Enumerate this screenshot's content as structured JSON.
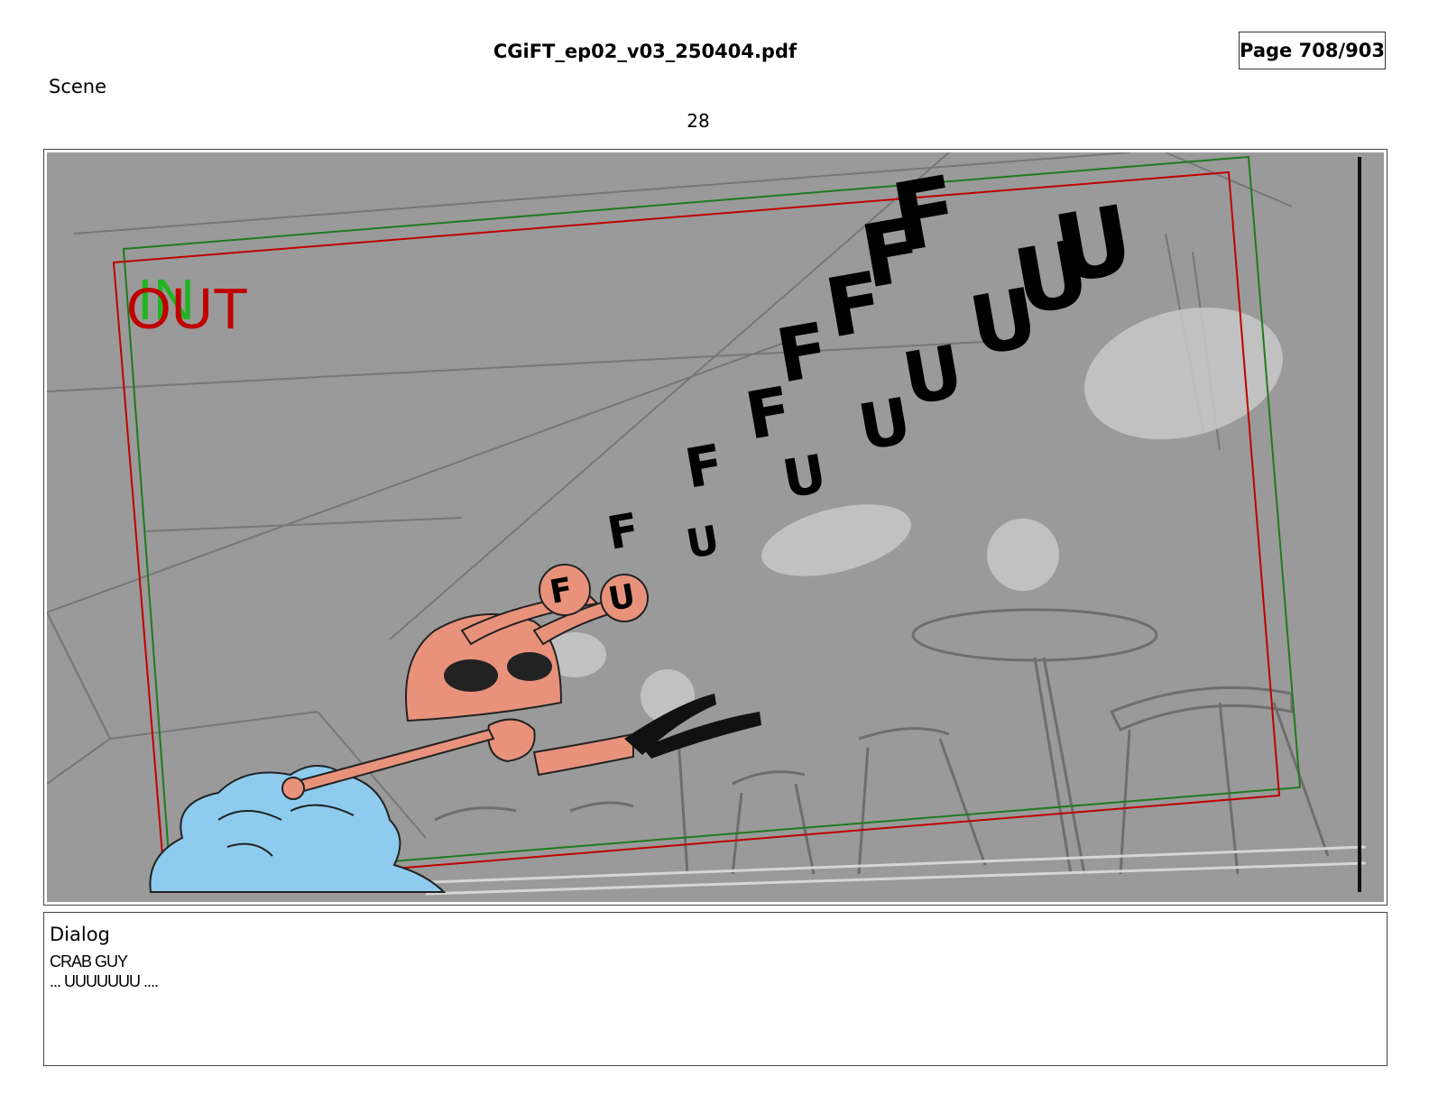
{
  "header": {
    "file_title": "CGiFT_ep02_v03_250404.pdf",
    "page_indicator": "Page 708/903"
  },
  "scene": {
    "label": "Scene",
    "number": "28"
  },
  "panel": {
    "in_label": "IN",
    "out_label": "OUT",
    "sfx_f": "F",
    "sfx_u": "U",
    "colors": {
      "background": "#9a9a9a",
      "in_frame": "#1f7a1f",
      "out_frame": "#c00000",
      "crab": "#e8927c",
      "blue_character": "#8ecbef",
      "sketch": "#6e6e6e"
    }
  },
  "dialog": {
    "label": "Dialog",
    "speaker": "CRAB GUY",
    "line": "... UUUUUUU ...."
  }
}
